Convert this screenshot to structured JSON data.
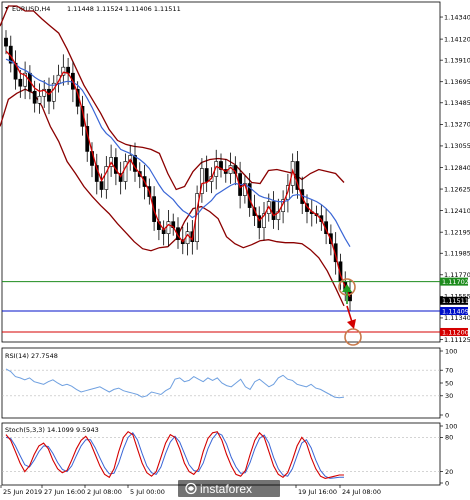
{
  "header": {
    "symbol_label": "EURUSD,H4",
    "ohlc": "1.11448 1.11524 1.11406 1.11511"
  },
  "rsi_panel": {
    "label": "RSI(14) 27.7548"
  },
  "stoch_panel": {
    "label": "Stoch(5,3,3) 14.1099 9.5943"
  },
  "watermark": {
    "text": "instaforex"
  },
  "colors": {
    "candle": "#000000",
    "bollinger": "#8b0000",
    "ema_fast": "#d40000",
    "ema_slow": "#3a66d6",
    "rsi_line": "#6fa0e0",
    "stoch_main": "#d40000",
    "stoch_signal": "#3a66d6",
    "support_line": "#1e8c1e",
    "entry_line": "#0010c8",
    "target_line": "#d40000",
    "annotation_circle": "#c8784a",
    "up_arrow": "#1e9c1e",
    "down_arrow": "#d40000"
  },
  "chart_data": [
    {
      "type": "candlestick",
      "ylim": [
        1.1112,
        1.1445
      ],
      "y_ticks": [
        "1.14340",
        "1.14120",
        "1.13910",
        "1.13695",
        "1.13485",
        "1.13270",
        "1.13055",
        "1.12840",
        "1.12625",
        "1.12410",
        "1.12195",
        "1.11985",
        "1.11770",
        "1.11555",
        "1.11340",
        "1.11125"
      ],
      "x_labels": [
        "25 Jun 2019",
        "27 Jun 16:00",
        "2 Jul 08:00",
        "5 Jul 00:00",
        "19 Jul 16:00",
        "24 Jul 08:00"
      ],
      "price_labels": [
        {
          "text": "1.11702",
          "value": 1.11702,
          "color": "#1e8c1e"
        },
        {
          "text": "1.11511",
          "value": 1.11511,
          "color": "#000000"
        },
        {
          "text": "1.11409",
          "value": 1.11409,
          "color": "#0010c8"
        },
        {
          "text": "1.11200",
          "value": 1.112,
          "color": "#d40000"
        }
      ],
      "horizontal_levels": [
        1.11702,
        1.11409,
        1.112
      ],
      "close": [
        1.1405,
        1.1388,
        1.1372,
        1.1365,
        1.1378,
        1.136,
        1.1348,
        1.1355,
        1.1362,
        1.135,
        1.1368,
        1.1376,
        1.1384,
        1.1378,
        1.1362,
        1.1345,
        1.1325,
        1.13,
        1.1286,
        1.127,
        1.1262,
        1.1285,
        1.1294,
        1.1278,
        1.127,
        1.129,
        1.1296,
        1.128,
        1.1275,
        1.1265,
        1.1255,
        1.123,
        1.1222,
        1.1218,
        1.123,
        1.1224,
        1.1212,
        1.1208,
        1.122,
        1.121,
        1.1258,
        1.1283,
        1.127,
        1.1275,
        1.129,
        1.1282,
        1.1278,
        1.1286,
        1.1278,
        1.1256,
        1.1268,
        1.1244,
        1.1236,
        1.1224,
        1.1238,
        1.125,
        1.1232,
        1.124,
        1.1252,
        1.1266,
        1.129,
        1.1262,
        1.1248,
        1.124,
        1.1238,
        1.1236,
        1.123,
        1.1218,
        1.1208,
        1.119,
        1.117,
        1.116,
        1.1151
      ],
      "bb_upper": [
        1.1425,
        1.1445,
        1.1445,
        1.144,
        1.144,
        1.1432,
        1.1425,
        1.1418,
        1.1402,
        1.1384,
        1.1366,
        1.1352,
        1.1338,
        1.1322,
        1.1311,
        1.1307,
        1.1305,
        1.1304,
        1.1302,
        1.1298,
        1.1278,
        1.1262,
        1.1265,
        1.128,
        1.1289,
        1.1292,
        1.1293,
        1.1292,
        1.1287,
        1.1278,
        1.1269,
        1.1268,
        1.1281,
        1.1282,
        1.128,
        1.1278,
        1.1272,
        1.1278,
        1.1282,
        1.128,
        1.1278,
        1.1269
      ],
      "bb_lower": [
        1.1325,
        1.1352,
        1.1358,
        1.1362,
        1.1358,
        1.1345,
        1.1325,
        1.131,
        1.129,
        1.1278,
        1.1265,
        1.1255,
        1.1246,
        1.1238,
        1.1228,
        1.1219,
        1.121,
        1.1203,
        1.1201,
        1.1204,
        1.1205,
        1.1213,
        1.123,
        1.1243,
        1.1245,
        1.124,
        1.1233,
        1.1215,
        1.1208,
        1.1204,
        1.1207,
        1.1211,
        1.1212,
        1.121,
        1.1209,
        1.1209,
        1.1208,
        1.1202,
        1.1194,
        1.1181,
        1.1164,
        1.1146
      ],
      "ema_fast": [
        1.14,
        1.1395,
        1.1387,
        1.1378,
        1.1376,
        1.137,
        1.1363,
        1.136,
        1.1361,
        1.1357,
        1.1362,
        1.137,
        1.1379,
        1.1378,
        1.137,
        1.1358,
        1.1341,
        1.1318,
        1.13,
        1.1283,
        1.1271,
        1.1279,
        1.1289,
        1.1282,
        1.1275,
        1.1284,
        1.1292,
        1.1284,
        1.1278,
        1.127,
        1.126,
        1.1241,
        1.1229,
        1.1222,
        1.1227,
        1.1225,
        1.1216,
        1.121,
        1.1217,
        1.1212,
        1.1242,
        1.1268,
        1.1269,
        1.1273,
        1.1285,
        1.1283,
        1.128,
        1.1284,
        1.128,
        1.1264,
        1.1267,
        1.1252,
        1.1242,
        1.1231,
        1.1236,
        1.1245,
        1.1236,
        1.1239,
        1.1248,
        1.126,
        1.1281,
        1.1268,
        1.1254,
        1.1245,
        1.124,
        1.1237,
        1.1232,
        1.1222,
        1.1212,
        1.1196,
        1.1177,
        1.1165,
        1.1155
      ],
      "ema_slow": [
        1.1392,
        1.139,
        1.1387,
        1.1383,
        1.1381,
        1.1378,
        1.1374,
        1.1371,
        1.1369,
        1.1366,
        1.1366,
        1.1367,
        1.1369,
        1.137,
        1.1369,
        1.1366,
        1.1361,
        1.1353,
        1.1344,
        1.1334,
        1.1324,
        1.1318,
        1.1314,
        1.1308,
        1.1302,
        1.13,
        1.1298,
        1.1295,
        1.1292,
        1.1288,
        1.1283,
        1.1275,
        1.1267,
        1.126,
        1.1256,
        1.1252,
        1.1246,
        1.1241,
        1.1238,
        1.1234,
        1.1237,
        1.1243,
        1.1247,
        1.1251,
        1.1257,
        1.126,
        1.1263,
        1.1266,
        1.1268,
        1.1267,
        1.1267,
        1.1264,
        1.126,
        1.1256,
        1.1254,
        1.1253,
        1.1251,
        1.125,
        1.125,
        1.1251,
        1.1256,
        1.1257,
        1.1256,
        1.1254,
        1.1252,
        1.125,
        1.1247,
        1.1243,
        1.1238,
        1.1231,
        1.1222,
        1.1213,
        1.1205
      ]
    },
    {
      "type": "line",
      "title": "RSI(14) 27.7548",
      "ylim": [
        0,
        100
      ],
      "y_ticks": [
        "100",
        "70",
        "50",
        "30",
        "0"
      ],
      "values": [
        72,
        68,
        60,
        58,
        55,
        58,
        52,
        50,
        48,
        52,
        55,
        50,
        46,
        48,
        45,
        40,
        36,
        38,
        40,
        42,
        44,
        40,
        36,
        40,
        42,
        38,
        36,
        34,
        32,
        28,
        30,
        36,
        34,
        32,
        38,
        42,
        56,
        58,
        52,
        54,
        60,
        56,
        52,
        58,
        54,
        58,
        50,
        46,
        44,
        50,
        56,
        44,
        40,
        52,
        56,
        50,
        44,
        48,
        58,
        62,
        56,
        54,
        48,
        46,
        44,
        48,
        42,
        40,
        36,
        32,
        28,
        27,
        28
      ]
    },
    {
      "type": "line",
      "title": "Stoch(5,3,3) 14.1099 9.5943",
      "ylim": [
        0,
        100
      ],
      "y_ticks": [
        "100",
        "80",
        "20",
        "0"
      ],
      "series": [
        {
          "values": [
            85,
            75,
            55,
            35,
            20,
            30,
            50,
            65,
            70,
            60,
            40,
            25,
            18,
            22,
            40,
            60,
            75,
            82,
            70,
            50,
            30,
            15,
            10,
            25,
            55,
            80,
            90,
            85,
            60,
            35,
            18,
            12,
            20,
            45,
            70,
            85,
            80,
            60,
            35,
            20,
            15,
            25,
            55,
            78,
            88,
            90,
            75,
            50,
            30,
            15,
            12,
            22,
            50,
            75,
            88,
            80,
            55,
            30,
            15,
            10,
            18,
            40,
            65,
            80,
            70,
            45,
            25,
            12,
            8,
            10,
            12,
            14,
            14
          ]
        },
        {
          "values": [
            80,
            78,
            65,
            48,
            32,
            28,
            40,
            55,
            65,
            64,
            52,
            36,
            24,
            20,
            30,
            48,
            65,
            76,
            76,
            62,
            44,
            27,
            16,
            17,
            35,
            60,
            80,
            88,
            76,
            52,
            30,
            18,
            15,
            28,
            52,
            72,
            82,
            72,
            52,
            32,
            22,
            20,
            35,
            60,
            78,
            88,
            84,
            68,
            45,
            28,
            17,
            18,
            36,
            60,
            78,
            84,
            70,
            45,
            25,
            14,
            12,
            25,
            48,
            70,
            76,
            62,
            40,
            22,
            12,
            8,
            9,
            10,
            10
          ]
        }
      ]
    }
  ]
}
